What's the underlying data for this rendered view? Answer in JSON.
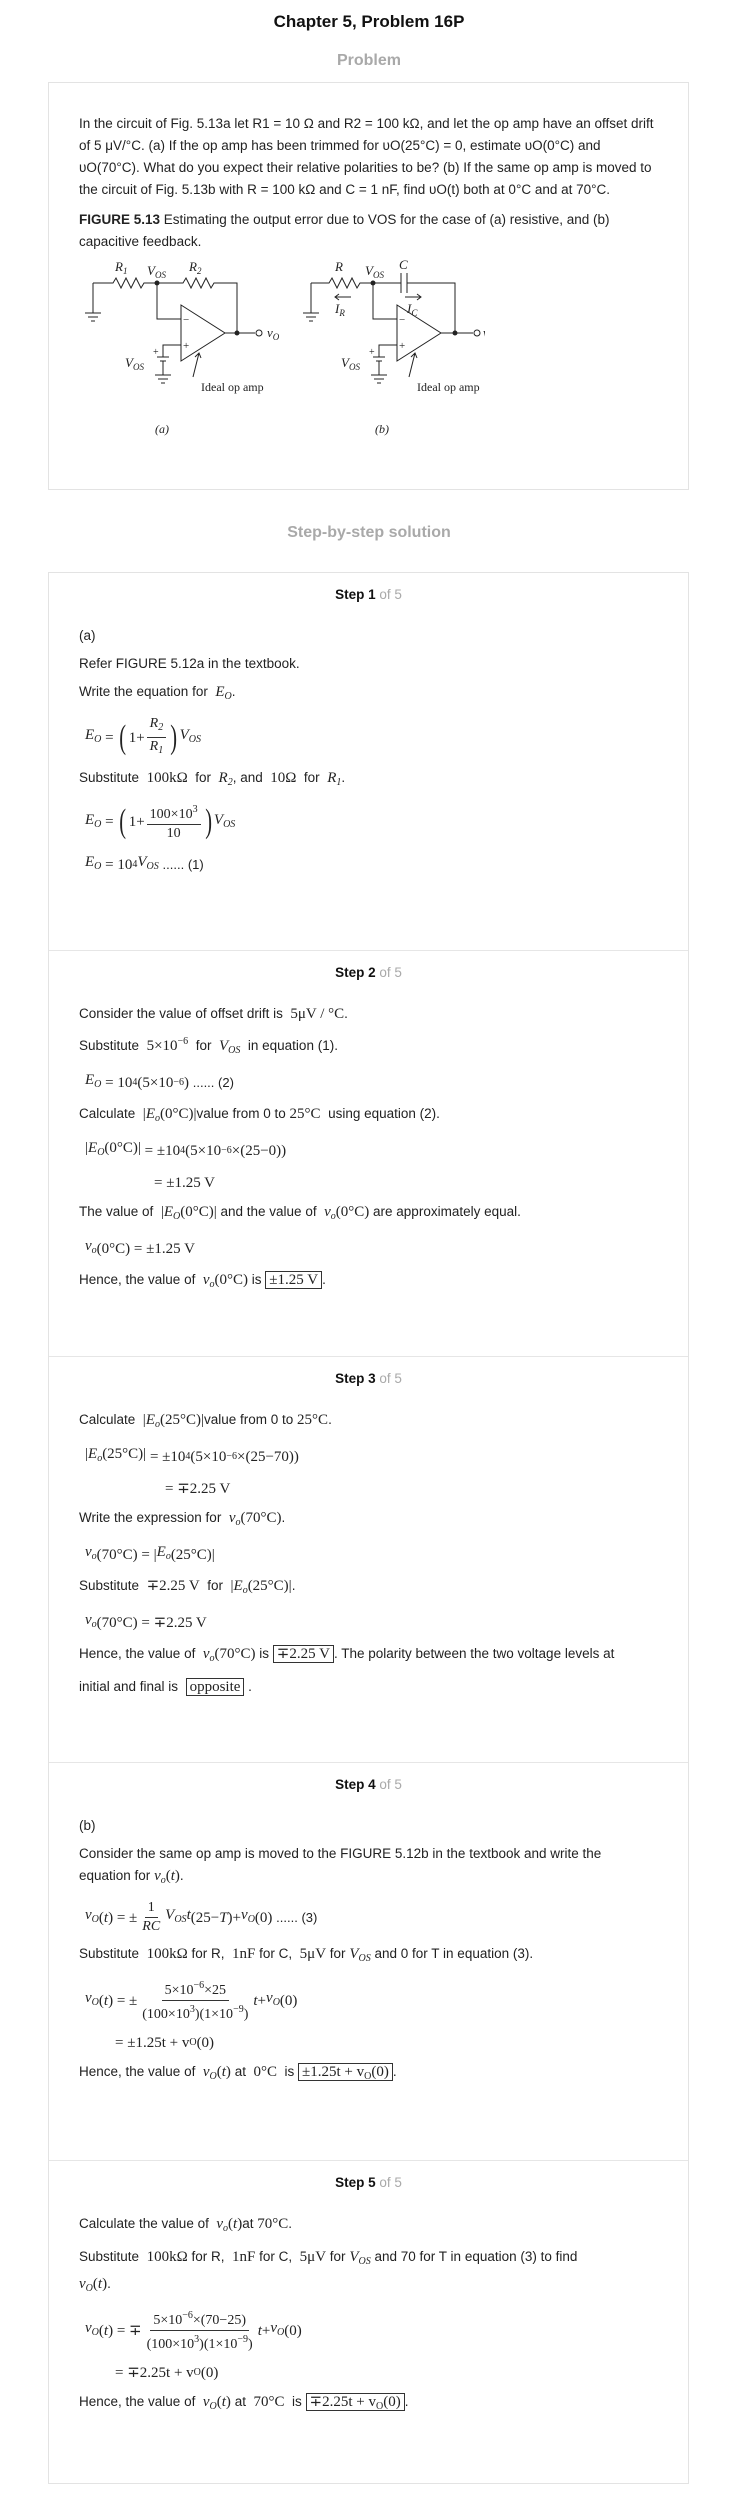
{
  "title": "Chapter 5, Problem 16P",
  "problem_heading": "Problem",
  "problem": {
    "text": "In the circuit of Fig. 5.13a let R1 = 10 Ω and R2 = 100 kΩ, and let the op amp have an offset drift of 5 μV/°C. (a) If the op amp has been trimmed for υO(25°C) = 0, estimate υO(0°C) and υO(70°C). What do you expect their relative polarities to be? (b) If the same op amp is moved to the circuit of Fig. 5.13b with R = 100 kΩ and C = 1 nF, find υO(t) both at 0°C and at 70°C.",
    "figure_label": "FIGURE 5.13",
    "figure_caption": " Estimating the output error due to VOS for the case of (a) resistive, and (b) capacitive feedback.",
    "fig_a": {
      "r1": "R",
      "r1_sub": "1",
      "r2": "R",
      "r2_sub": "2",
      "vos": "V",
      "vos_sub": "OS",
      "out": "v",
      "out_sub": "O",
      "vos2": "V",
      "vos2_sub": "OS",
      "opamp_label": "Ideal op amp",
      "tag": "(a)"
    },
    "fig_b": {
      "r": "R",
      "c": "C",
      "vos": "V",
      "vos_sub": "OS",
      "ir": "I",
      "ir_sub": "R",
      "ic": "I",
      "ic_sub": "C",
      "out": "v",
      "out_sub": "O",
      "vos2": "V",
      "vos2_sub": "OS",
      "opamp_label": "Ideal op amp",
      "tag": "(b)"
    }
  },
  "solution_heading": "Step-by-step solution",
  "steps": [
    {
      "label": "Step 1",
      "of": " of 5"
    },
    {
      "label": "Step 2",
      "of": " of 5"
    },
    {
      "label": "Step 3",
      "of": " of 5"
    },
    {
      "label": "Step 4",
      "of": " of 5"
    },
    {
      "label": "Step 5",
      "of": " of 5"
    }
  ],
  "s1": {
    "part": "(a)",
    "l1": "Refer FIGURE 5.12a in the textbook.",
    "l2": "Write the equation for",
    "l3a": "Substitute",
    "l3b": "100kΩ",
    "l3c": "for",
    "l3d": ", and",
    "l3e": "10Ω",
    "l3f": "for",
    "eq3_tail": "...... (1)"
  },
  "s2": {
    "l1a": "Consider the value of offset drift is",
    "l1b": "5μV / °C",
    "l2a": "Substitute",
    "l2b": "5×10",
    "l2c": "for",
    "l2d": "in equation (1).",
    "eq1_tail": "...... (2)",
    "l3a": "Calculate",
    "l3b": "value from 0 to",
    "l3c": "25°C",
    "l3d": "using equation (2).",
    "eq2a": "= ±10",
    "eq2b": "= ±1.25 V",
    "l4a": "The value of",
    "l4b": "and the value of",
    "l4c": "are approximately equal.",
    "eq3": "= ±1.25 V",
    "l5a": "Hence, the value of",
    "l5b": "is",
    "ans": "±1.25 V"
  },
  "s3": {
    "l1a": "Calculate",
    "l1b": "value from 0 to",
    "l1c": "25°C",
    "eq1a": "= ±10",
    "eq1b": "= ∓2.25 V",
    "l2a": "Write the expression for",
    "l3a": "Substitute",
    "l3b": "∓2.25 V",
    "l3c": "for",
    "eq3": "= ∓2.25 V",
    "l4a": "Hence, the value of",
    "l4b": "is",
    "ans": "∓2.25 V",
    "l4c": ". The polarity between the two voltage levels at",
    "l5a": "initial and final is",
    "ans2": "opposite"
  },
  "s4": {
    "part": "(b)",
    "l1": "Consider the same op amp is moved to the FIGURE 5.12b in the textbook and write the",
    "l2": "equation for",
    "eq1_tail": "...... (3)",
    "l3a": "Substitute",
    "l3b": "100kΩ",
    "l3c": "for R,",
    "l3d": "1nF",
    "l3e": "for C,",
    "l3f": "5μV",
    "l3g": "for",
    "l3h": "and 0 for T in equation (3).",
    "eq3": "= ±1.25t + v",
    "l4a": "Hence, the value of",
    "l4b": "at",
    "l4c": "0°C",
    "l4d": "is",
    "ans": "±1.25t + v"
  },
  "s5": {
    "l1a": "Calculate the value of",
    "l1b": "at",
    "l1c": "70°C",
    "l2a": "Substitute",
    "l2b": "100kΩ",
    "l2c": "for R,",
    "l2d": "1nF",
    "l2e": "for C,",
    "l2f": "5μV",
    "l2g": "for",
    "l2h": "and 70 for T in equation (3) to find",
    "eq3": "= ∓2.25t + v",
    "l4a": "Hence, the value of",
    "l4b": "at",
    "l4c": "70°C",
    "l4d": "is",
    "ans": "∓2.25t + v"
  }
}
